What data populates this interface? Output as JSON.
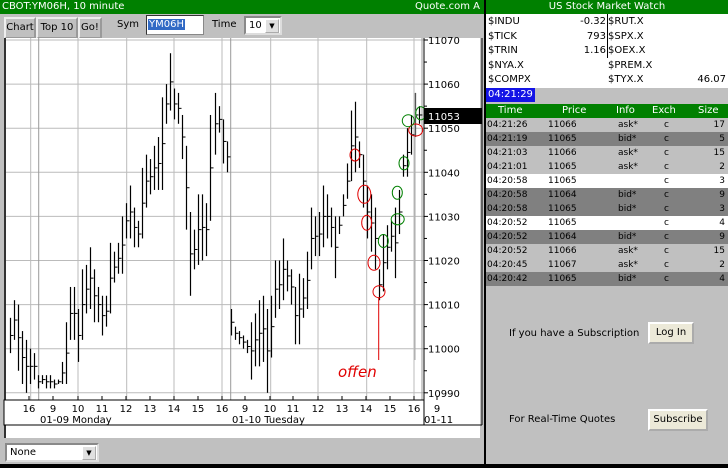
{
  "window": {
    "title": "CBOT:YM06H, 10 minute",
    "brand": "Quote.com  A"
  },
  "toolbar": {
    "chart_label": "Chart",
    "top10_label": "Top 10",
    "go_label": "Go!",
    "sym_label": "Sym",
    "sym_value": "YM06H",
    "time_label": "Time",
    "time_value": "10"
  },
  "study_select": {
    "value": "None"
  },
  "last_price": "11053",
  "annotation_text": "offen",
  "colors": {
    "green": "#008000",
    "gray": "#c0c0c0",
    "dark_gray": "#808080",
    "ask_row": "#c0c0c0",
    "bid_row": "#808080",
    "plain_row": "#ffffff",
    "annotation_red": "#e00000",
    "annotation_green": "#008000"
  },
  "chart_data": {
    "type": "ohlc",
    "title": "CBOT:YM06H, 10 minute",
    "ylim": [
      10990,
      11070
    ],
    "y_ticks": [
      "11070",
      "11060",
      "11050",
      "11040",
      "11030",
      "11020",
      "11010",
      "11000",
      "10990"
    ],
    "x_ticks": [
      "16",
      "9",
      "10",
      "11",
      "12",
      "13",
      "14",
      "15",
      "16",
      "9",
      "10",
      "11",
      "12",
      "13",
      "14",
      "15",
      "16",
      "9"
    ],
    "day_labels": [
      "01-09 Monday",
      "01-10 Tuesday",
      "01-11"
    ],
    "bars_high_low": [
      [
        11007,
        10999
      ],
      [
        11011,
        11002
      ],
      [
        11010,
        10995
      ],
      [
        11004,
        10992
      ],
      [
        11002,
        10990
      ],
      [
        11000,
        10992
      ],
      [
        10999,
        10993
      ],
      [
        10994,
        10991
      ],
      [
        10994,
        10992
      ],
      [
        10994,
        10991
      ],
      [
        10994,
        10991
      ],
      [
        10993,
        10991
      ],
      [
        10993,
        10992
      ],
      [
        10997,
        10992
      ],
      [
        11006,
        10992
      ],
      [
        11014,
        11002
      ],
      [
        11014,
        11002
      ],
      [
        11009,
        10997
      ],
      [
        11018,
        11002
      ],
      [
        11019,
        11008
      ],
      [
        11023,
        11009
      ],
      [
        11018,
        11006
      ],
      [
        11014,
        11006
      ],
      [
        11012,
        11003
      ],
      [
        11012,
        11005
      ],
      [
        11024,
        11008
      ],
      [
        11022,
        11015
      ],
      [
        11024,
        11017
      ],
      [
        11030,
        11017
      ],
      [
        11033,
        11025
      ],
      [
        11037,
        11025
      ],
      [
        11032,
        11023
      ],
      [
        11029,
        11023
      ],
      [
        11041,
        11025
      ],
      [
        11044,
        11032
      ],
      [
        11043,
        11035
      ],
      [
        11046,
        11036
      ],
      [
        11048,
        11036
      ],
      [
        11057,
        11036
      ],
      [
        11060,
        11051
      ],
      [
        11067,
        11054
      ],
      [
        11059,
        11052
      ],
      [
        11058,
        11051
      ],
      [
        11053,
        11043
      ],
      [
        11046,
        11027
      ],
      [
        11031,
        11012
      ],
      [
        11027,
        11018
      ],
      [
        11035,
        11019
      ],
      [
        11035,
        11020
      ],
      [
        11033,
        11021
      ],
      [
        11053,
        11029
      ],
      [
        11058,
        11044
      ],
      [
        11055,
        11049
      ],
      [
        11052,
        11042
      ],
      [
        11047,
        11040
      ],
      [
        11009,
        11003
      ],
      [
        11005,
        11002
      ],
      [
        11004,
        11001
      ],
      [
        11003,
        11000
      ],
      [
        11002,
        10999
      ],
      [
        11006,
        10993
      ],
      [
        11008,
        10996
      ],
      [
        11011,
        10996
      ],
      [
        11012,
        10997
      ],
      [
        11009,
        10990
      ],
      [
        11012,
        10998
      ],
      [
        11020,
        11007
      ],
      [
        11020,
        11009
      ],
      [
        11025,
        11011
      ],
      [
        11020,
        11013
      ],
      [
        11018,
        11010
      ],
      [
        11014,
        11001
      ],
      [
        11017,
        11001
      ],
      [
        11016,
        11007
      ],
      [
        11022,
        11009
      ],
      [
        11032,
        11018
      ],
      [
        11030,
        11021
      ],
      [
        11031,
        11021
      ],
      [
        11037,
        11023
      ],
      [
        11035,
        11025
      ],
      [
        11032,
        11023
      ],
      [
        11030,
        11016
      ],
      [
        11030,
        11026
      ],
      [
        11035,
        11030
      ],
      [
        11042,
        11034
      ],
      [
        11054,
        11038
      ],
      [
        11056,
        11040
      ],
      [
        11047,
        11041
      ],
      [
        11044,
        11032
      ],
      [
        11037,
        11025
      ],
      [
        11035,
        11022
      ],
      [
        11032,
        11018
      ],
      [
        11018,
        11011
      ],
      [
        11026,
        11013
      ],
      [
        11028,
        11018
      ],
      [
        11029,
        11022
      ],
      [
        11032,
        11016
      ],
      [
        11036,
        11026
      ],
      [
        11044,
        11039
      ],
      [
        11050,
        11039
      ],
      [
        11053,
        11044
      ],
      [
        11058,
        11048
      ],
      [
        11055,
        11051
      ]
    ]
  },
  "market_watch": {
    "title": "US Stock Market Watch",
    "left": [
      {
        "symbol": "$INDU",
        "value": "-0.32"
      },
      {
        "symbol": "$TICK",
        "value": "793"
      },
      {
        "symbol": "$TRIN",
        "value": "1.16"
      },
      {
        "symbol": "$NYA.X",
        "value": ""
      },
      {
        "symbol": "$COMPX",
        "value": ""
      }
    ],
    "right": [
      {
        "symbol": "$RUT.X",
        "value": ""
      },
      {
        "symbol": "$SPX.X",
        "value": ""
      },
      {
        "symbol": "$OEX.X",
        "value": ""
      },
      {
        "symbol": "$PREM.X",
        "value": ""
      },
      {
        "symbol": "$TYX.X",
        "value": "46.07"
      }
    ]
  },
  "clock": "04:21:29",
  "trades": {
    "headers": [
      "Time",
      "Price",
      "Info",
      "Exch",
      "Size"
    ],
    "rows": [
      {
        "time": "04:21:26",
        "price": "11066",
        "info": "ask*",
        "exch": "c",
        "size": "17",
        "kind": "ask"
      },
      {
        "time": "04:21:19",
        "price": "11065",
        "info": "bid*",
        "exch": "c",
        "size": "5",
        "kind": "bid"
      },
      {
        "time": "04:21:03",
        "price": "11066",
        "info": "ask*",
        "exch": "c",
        "size": "15",
        "kind": "ask"
      },
      {
        "time": "04:21:01",
        "price": "11065",
        "info": "ask*",
        "exch": "c",
        "size": "2",
        "kind": "ask"
      },
      {
        "time": "04:20:58",
        "price": "11065",
        "info": "",
        "exch": "c",
        "size": "3",
        "kind": "plain"
      },
      {
        "time": "04:20:58",
        "price": "11064",
        "info": "bid*",
        "exch": "c",
        "size": "9",
        "kind": "bid"
      },
      {
        "time": "04:20:58",
        "price": "11065",
        "info": "bid*",
        "exch": "c",
        "size": "3",
        "kind": "bid"
      },
      {
        "time": "04:20:52",
        "price": "11065",
        "info": "",
        "exch": "c",
        "size": "4",
        "kind": "plain"
      },
      {
        "time": "04:20:52",
        "price": "11064",
        "info": "bid*",
        "exch": "c",
        "size": "9",
        "kind": "bid"
      },
      {
        "time": "04:20:52",
        "price": "11066",
        "info": "ask*",
        "exch": "c",
        "size": "15",
        "kind": "ask"
      },
      {
        "time": "04:20:45",
        "price": "11067",
        "info": "ask*",
        "exch": "c",
        "size": "2",
        "kind": "ask"
      },
      {
        "time": "04:20:42",
        "price": "11065",
        "info": "bid*",
        "exch": "c",
        "size": "4",
        "kind": "bid"
      }
    ]
  },
  "subscription": {
    "login_prompt": "If you have a Subscription",
    "login_label": "Log In",
    "subscribe_prompt": "For Real-Time Quotes",
    "subscribe_label": "Subscribe"
  }
}
